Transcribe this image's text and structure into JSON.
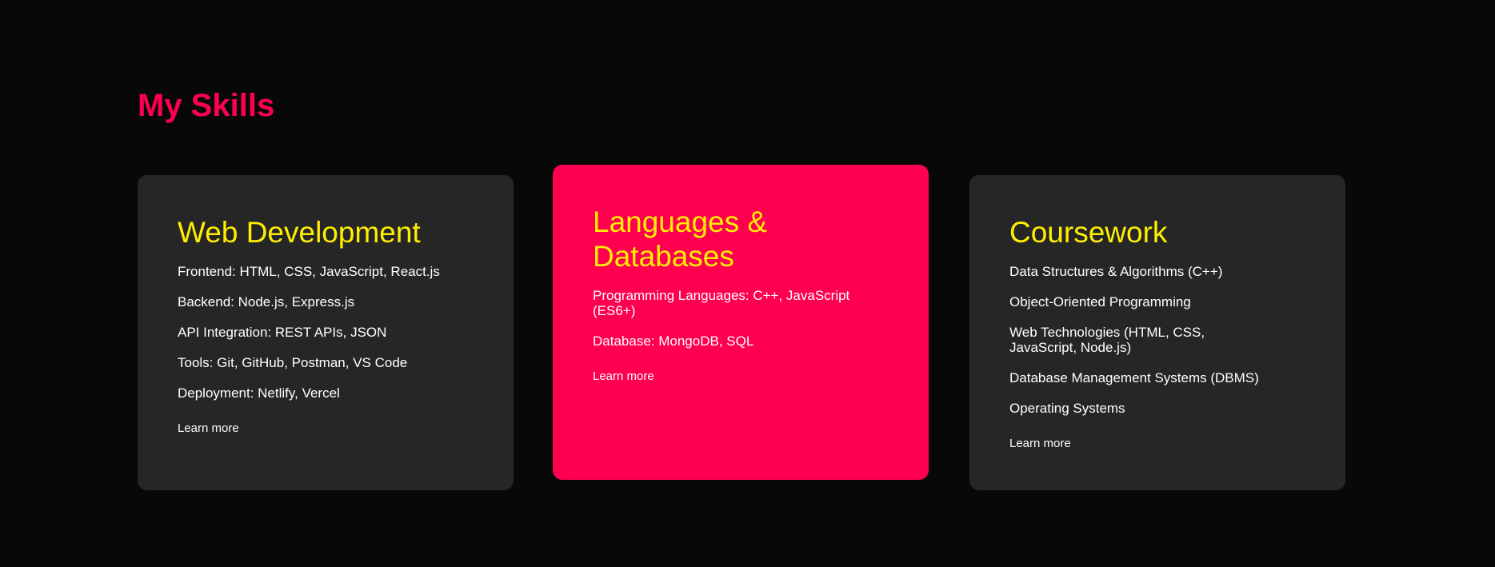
{
  "section": {
    "title": "My Skills"
  },
  "colors": {
    "background": "#080808",
    "accent": "#ff0050",
    "card_background": "#262626",
    "card_title": "#ffee00",
    "text": "#ffffff"
  },
  "cards": [
    {
      "title": "Web Development",
      "items": [
        "Frontend: HTML, CSS, JavaScript, React.js",
        "Backend: Node.js, Express.js",
        "API Integration: REST APIs, JSON",
        "Tools: Git, GitHub, Postman, VS Code",
        "Deployment: Netlify, Vercel"
      ],
      "link_label": "Learn more"
    },
    {
      "title": "Languages & Databases",
      "items": [
        "Programming Languages: C++, JavaScript (ES6+)",
        "Database: MongoDB, SQL"
      ],
      "link_label": "Learn more"
    },
    {
      "title": "Coursework",
      "items": [
        "Data Structures & Algorithms (C++)",
        "Object-Oriented Programming",
        "Web Technologies (HTML, CSS, JavaScript, Node.js)",
        "Database Management Systems (DBMS)",
        "Operating Systems"
      ],
      "link_label": "Learn more"
    }
  ]
}
